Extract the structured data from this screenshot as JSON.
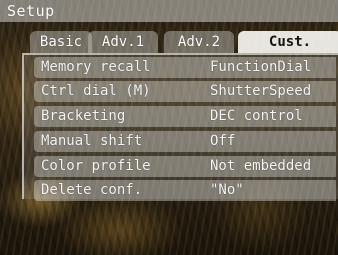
{
  "title": "Setup",
  "tabs": [
    {
      "label": "Basic",
      "active": false
    },
    {
      "label": "Adv.1",
      "active": false
    },
    {
      "label": "Adv.2",
      "active": false
    },
    {
      "label": "Cust.",
      "active": true
    }
  ],
  "rows": [
    {
      "label": "Memory recall",
      "value": "FunctionDial"
    },
    {
      "label": "Ctrl dial (M)",
      "value": "ShutterSpeed"
    },
    {
      "label": "Bracketing",
      "value": "DEC control"
    },
    {
      "label": "Manual shift",
      "value": "Off"
    },
    {
      "label": "Color profile",
      "value": "Not embedded"
    },
    {
      "label": "Delete conf.",
      "value": "\"No\""
    }
  ]
}
